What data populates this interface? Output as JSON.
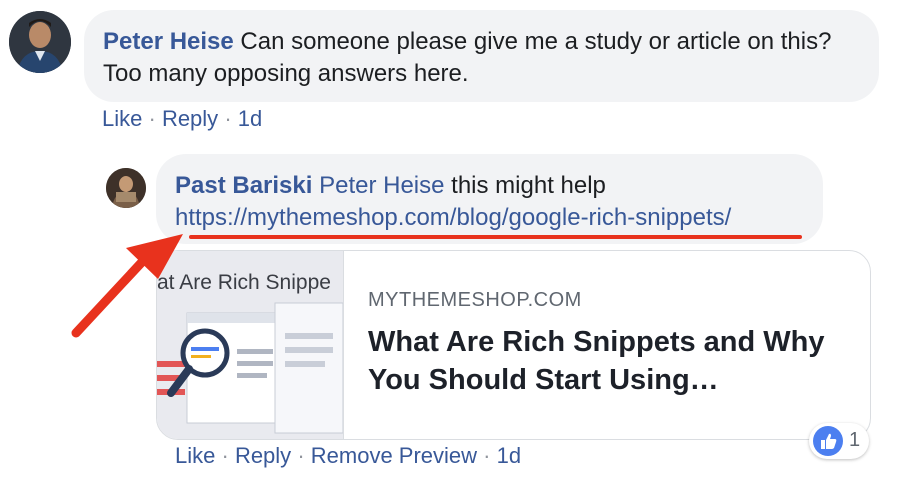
{
  "comment": {
    "author": "Peter Heise",
    "text": "Can someone please give me a study or article on this? Too many opposing answers here.",
    "actions": {
      "like": "Like",
      "reply": "Reply",
      "separator": "·",
      "time": "1d"
    }
  },
  "reply": {
    "author": "Past Bariski",
    "mention": "Peter Heise",
    "text": "this might help",
    "url": "https://mythemeshop.com/blog/google-rich-snippets/",
    "preview": {
      "thumb_title": "at Are Rich Snippe",
      "domain": "MYTHEMESHOP.COM",
      "title": "What Are Rich Snippets and Why You Should Start Using…"
    },
    "actions": {
      "like": "Like",
      "reply": "Reply",
      "remove_preview": "Remove Preview",
      "separator": "·",
      "time": "1d"
    },
    "reaction": {
      "icon": "thumbs-up-icon",
      "count": "1"
    }
  },
  "colors": {
    "name": "#385898",
    "bubble": "#f2f3f5",
    "annotation": "#e8321d",
    "like_badge": "#4c7ff0"
  }
}
